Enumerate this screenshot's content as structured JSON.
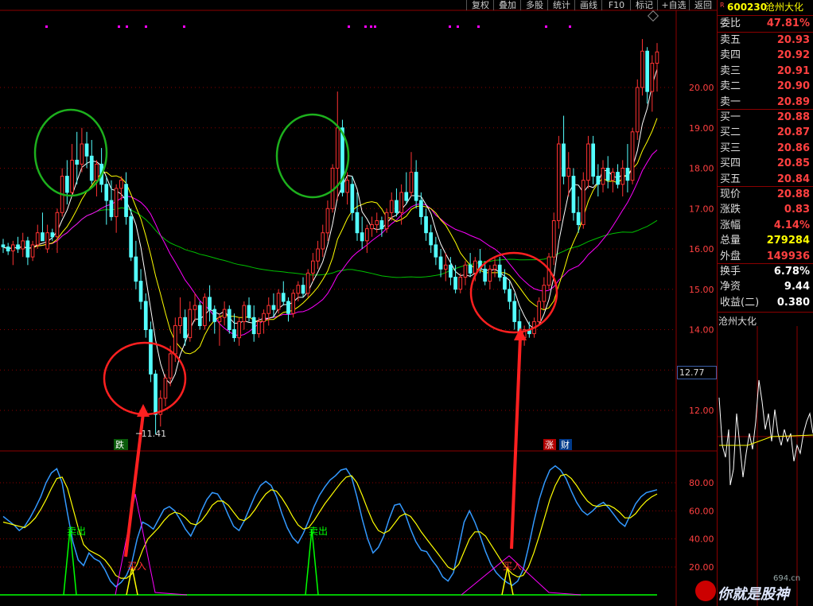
{
  "toolbar": [
    "复权",
    "叠加",
    "多股",
    "统计",
    "画线",
    "F10",
    "标记",
    "+自选",
    "返回"
  ],
  "stock": {
    "code": "600230",
    "name": "沧州大化",
    "marker": "R"
  },
  "quote": {
    "ratio_label": "委比",
    "ratio_value": "47.81%",
    "asks": [
      {
        "label": "卖五",
        "price": "20.93"
      },
      {
        "label": "卖四",
        "price": "20.92"
      },
      {
        "label": "卖三",
        "price": "20.91"
      },
      {
        "label": "卖二",
        "price": "20.90"
      },
      {
        "label": "卖一",
        "price": "20.89"
      }
    ],
    "bids": [
      {
        "label": "买一",
        "price": "20.88"
      },
      {
        "label": "买二",
        "price": "20.87"
      },
      {
        "label": "买三",
        "price": "20.86"
      },
      {
        "label": "买四",
        "price": "20.85"
      },
      {
        "label": "买五",
        "price": "20.84"
      }
    ],
    "stats": [
      {
        "label": "现价",
        "value": "20.88",
        "color": "#ff4040"
      },
      {
        "label": "涨跌",
        "value": "0.83",
        "color": "#ff4040"
      },
      {
        "label": "涨幅",
        "value": "4.14%",
        "color": "#ff4040"
      },
      {
        "label": "总量",
        "value": "279284",
        "color": "#ffff00"
      },
      {
        "label": "外盘",
        "value": "149936",
        "color": "#ff4040"
      }
    ],
    "stats2": [
      {
        "label": "换手",
        "value": "6.78%",
        "color": "#ffffff"
      },
      {
        "label": "净资",
        "value": "9.44",
        "color": "#ffffff"
      },
      {
        "label": "收益(二)",
        "value": "0.380",
        "color": "#ffffff"
      }
    ]
  },
  "mini_chart": {
    "title": "沧州大化"
  },
  "cursor_price": "12.77",
  "low_label": "11.41",
  "tags": {
    "die": "跌",
    "zhang": "涨",
    "cai": "财"
  },
  "signals": {
    "sell": "卖出",
    "buy": "买入"
  },
  "watermark": {
    "text": "你就是股神",
    "site": "694.cn"
  },
  "colors": {
    "up": "#ff3232",
    "down": "#54ffff",
    "ma5": "#ffffff",
    "ma10": "#ffff00",
    "ma20": "#ff00ff",
    "ma60": "#00c000",
    "k_line": "#ffff00",
    "d_line": "#3399ff",
    "circle_green": "#1db01d",
    "circle_red": "#ff2020"
  },
  "chart_data": [
    {
      "type": "candlestick",
      "y_ticks": [
        12.0,
        13.0,
        14.0,
        15.0,
        16.0,
        17.0,
        18.0,
        19.0,
        20.0
      ],
      "ylim": [
        11.0,
        21.0
      ],
      "candles": [
        [
          16.1,
          16.25,
          15.9,
          16.05
        ],
        [
          16.05,
          16.15,
          15.85,
          15.95
        ],
        [
          15.95,
          16.2,
          15.6,
          16.1
        ],
        [
          16.1,
          16.3,
          15.9,
          16.0
        ],
        [
          16.0,
          16.4,
          15.8,
          16.2
        ],
        [
          16.2,
          16.3,
          15.6,
          15.8
        ],
        [
          15.8,
          16.2,
          15.7,
          16.1
        ],
        [
          16.1,
          16.6,
          16.0,
          16.4
        ],
        [
          16.4,
          16.9,
          16.3,
          16.2
        ],
        [
          16.0,
          16.6,
          15.9,
          16.4
        ],
        [
          16.4,
          16.5,
          16.2,
          16.3
        ],
        [
          16.3,
          17.0,
          15.9,
          16.9
        ],
        [
          16.9,
          18.0,
          16.8,
          17.8
        ],
        [
          17.8,
          18.2,
          17.1,
          17.4
        ],
        [
          17.4,
          18.6,
          17.3,
          18.2
        ],
        [
          18.2,
          18.9,
          17.6,
          18.1
        ],
        [
          18.1,
          19.0,
          17.9,
          18.6
        ],
        [
          18.6,
          18.9,
          18.0,
          18.3
        ],
        [
          18.3,
          18.7,
          17.6,
          17.7
        ],
        [
          17.7,
          18.2,
          17.3,
          18.1
        ],
        [
          18.1,
          18.5,
          17.4,
          17.6
        ],
        [
          17.6,
          17.8,
          16.6,
          17.2
        ],
        [
          17.2,
          17.7,
          16.7,
          16.8
        ],
        [
          16.8,
          17.6,
          16.4,
          17.5
        ],
        [
          17.5,
          17.8,
          17.2,
          17.7
        ],
        [
          17.6,
          17.9,
          16.6,
          16.8
        ],
        [
          16.8,
          17.0,
          15.7,
          15.8
        ],
        [
          15.8,
          16.2,
          15.0,
          15.2
        ],
        [
          15.2,
          15.5,
          14.5,
          14.7
        ],
        [
          14.7,
          14.9,
          13.8,
          14.0
        ],
        [
          14.0,
          14.2,
          12.7,
          12.9
        ],
        [
          12.9,
          13.0,
          11.41,
          11.9
        ],
        [
          11.9,
          12.5,
          11.6,
          12.3
        ],
        [
          12.3,
          12.9,
          12.1,
          12.8
        ],
        [
          12.8,
          13.6,
          12.6,
          13.4
        ],
        [
          13.4,
          14.3,
          13.2,
          14.1
        ],
        [
          14.1,
          14.8,
          13.9,
          14.3
        ],
        [
          14.3,
          14.5,
          13.6,
          13.8
        ],
        [
          13.8,
          14.7,
          13.7,
          14.5
        ],
        [
          14.5,
          14.9,
          14.2,
          14.6
        ],
        [
          14.6,
          14.7,
          14.0,
          14.1
        ],
        [
          14.1,
          14.9,
          14.0,
          14.8
        ],
        [
          14.8,
          15.1,
          14.2,
          14.5
        ],
        [
          14.5,
          14.6,
          13.9,
          14.2
        ],
        [
          14.2,
          14.4,
          13.6,
          14.3
        ],
        [
          14.3,
          14.7,
          14.1,
          14.5
        ],
        [
          14.5,
          14.6,
          13.9,
          14.0
        ],
        [
          14.0,
          14.4,
          13.7,
          13.8
        ],
        [
          13.8,
          14.3,
          13.6,
          14.2
        ],
        [
          14.2,
          14.7,
          14.0,
          14.6
        ],
        [
          14.6,
          14.8,
          14.2,
          14.3
        ],
        [
          14.3,
          14.6,
          13.7,
          13.9
        ],
        [
          13.9,
          14.3,
          13.8,
          14.2
        ],
        [
          14.2,
          14.5,
          13.9,
          14.4
        ],
        [
          14.4,
          14.8,
          14.1,
          14.6
        ],
        [
          14.6,
          14.9,
          14.3,
          14.5
        ],
        [
          14.5,
          15.0,
          14.4,
          14.9
        ],
        [
          14.9,
          15.2,
          14.6,
          14.7
        ],
        [
          14.7,
          14.8,
          14.2,
          14.4
        ],
        [
          14.4,
          15.0,
          14.3,
          14.9
        ],
        [
          14.9,
          15.2,
          14.7,
          15.1
        ],
        [
          15.1,
          15.3,
          14.8,
          14.9
        ],
        [
          14.9,
          15.5,
          14.8,
          15.4
        ],
        [
          15.4,
          15.9,
          15.2,
          15.7
        ],
        [
          15.7,
          16.2,
          15.5,
          16.0
        ],
        [
          16.0,
          16.6,
          15.8,
          16.4
        ],
        [
          16.4,
          17.2,
          16.2,
          17.0
        ],
        [
          17.0,
          18.1,
          16.9,
          18.0
        ],
        [
          18.0,
          19.9,
          17.2,
          19.0
        ],
        [
          19.0,
          19.2,
          17.3,
          17.4
        ],
        [
          17.4,
          17.9,
          17.1,
          17.7
        ],
        [
          17.6,
          17.8,
          16.7,
          16.9
        ],
        [
          16.9,
          17.4,
          16.2,
          16.4
        ],
        [
          16.4,
          16.8,
          16.0,
          16.2
        ],
        [
          16.2,
          16.6,
          15.9,
          16.5
        ],
        [
          16.5,
          16.8,
          16.3,
          16.6
        ],
        [
          16.6,
          16.9,
          16.4,
          16.7
        ],
        [
          16.7,
          16.8,
          16.3,
          16.5
        ],
        [
          16.5,
          17.0,
          16.4,
          16.9
        ],
        [
          16.9,
          17.4,
          16.7,
          17.2
        ],
        [
          17.2,
          17.5,
          16.8,
          16.9
        ],
        [
          16.9,
          17.6,
          16.6,
          17.4
        ],
        [
          17.4,
          17.9,
          17.1,
          17.2
        ],
        [
          17.4,
          18.4,
          17.3,
          17.9
        ],
        [
          17.9,
          18.2,
          17.0,
          17.2
        ],
        [
          17.2,
          17.4,
          16.6,
          16.8
        ],
        [
          16.8,
          17.0,
          16.2,
          16.4
        ],
        [
          16.4,
          16.6,
          15.9,
          16.1
        ],
        [
          16.1,
          16.3,
          15.6,
          15.8
        ],
        [
          15.8,
          16.0,
          15.3,
          15.5
        ],
        [
          15.5,
          15.9,
          15.2,
          15.6
        ],
        [
          15.6,
          15.8,
          15.1,
          15.3
        ],
        [
          15.3,
          15.6,
          14.9,
          15.0
        ],
        [
          15.0,
          15.4,
          14.9,
          15.3
        ],
        [
          15.3,
          15.7,
          15.1,
          15.6
        ],
        [
          15.6,
          15.9,
          15.3,
          15.4
        ],
        [
          15.4,
          15.8,
          15.2,
          15.7
        ],
        [
          15.7,
          16.0,
          15.4,
          15.5
        ],
        [
          15.5,
          15.7,
          15.1,
          15.2
        ],
        [
          15.2,
          15.6,
          15.0,
          15.5
        ],
        [
          15.5,
          15.8,
          15.3,
          15.6
        ],
        [
          15.6,
          15.8,
          15.2,
          15.3
        ],
        [
          15.3,
          15.5,
          14.9,
          15.0
        ],
        [
          15.0,
          15.2,
          14.5,
          14.7
        ],
        [
          14.7,
          14.9,
          14.0,
          14.2
        ],
        [
          14.2,
          14.5,
          13.7,
          13.8
        ],
        [
          13.8,
          14.1,
          13.6,
          14.0
        ],
        [
          14.0,
          14.2,
          13.8,
          13.9
        ],
        [
          13.9,
          14.3,
          13.8,
          14.2
        ],
        [
          14.2,
          14.8,
          14.1,
          14.7
        ],
        [
          14.7,
          15.3,
          14.5,
          15.1
        ],
        [
          15.1,
          15.9,
          15.0,
          15.8
        ],
        [
          15.8,
          16.9,
          15.6,
          16.7
        ],
        [
          16.7,
          18.8,
          16.5,
          18.6
        ],
        [
          18.6,
          19.3,
          17.6,
          17.8
        ],
        [
          17.8,
          18.4,
          17.3,
          18.0
        ],
        [
          17.8,
          18.0,
          16.7,
          16.9
        ],
        [
          16.9,
          17.3,
          16.4,
          16.6
        ],
        [
          16.6,
          17.9,
          16.5,
          17.7
        ],
        [
          17.7,
          18.8,
          17.5,
          18.6
        ],
        [
          18.6,
          18.8,
          17.6,
          17.8
        ],
        [
          17.8,
          18.1,
          17.3,
          17.6
        ],
        [
          17.6,
          18.2,
          17.4,
          18.0
        ],
        [
          18.0,
          18.3,
          17.5,
          17.7
        ],
        [
          17.7,
          18.0,
          17.4,
          17.9
        ],
        [
          17.9,
          18.1,
          17.5,
          17.6
        ],
        [
          17.6,
          18.2,
          17.3,
          18.0
        ],
        [
          18.0,
          18.6,
          17.4,
          17.7
        ],
        [
          17.7,
          19.0,
          17.6,
          18.9
        ],
        [
          18.9,
          20.2,
          18.7,
          20.0
        ],
        [
          20.0,
          21.2,
          19.8,
          20.9
        ],
        [
          20.9,
          21.0,
          19.6,
          19.9
        ],
        [
          19.9,
          20.8,
          19.4,
          20.6
        ],
        [
          20.6,
          21.1,
          19.9,
          20.88
        ]
      ],
      "annotations": [
        "跌",
        "11.41",
        "涨",
        "财"
      ]
    },
    {
      "type": "line",
      "y_ticks": [
        20.0,
        40.0,
        60.0,
        80.0
      ],
      "ylim": [
        0,
        100
      ],
      "series": [
        {
          "values": [
            56,
            53,
            50,
            46,
            49,
            55,
            62,
            70,
            80,
            87,
            90,
            80,
            58,
            38,
            25,
            21,
            30,
            26,
            24,
            18,
            10,
            6,
            9,
            14,
            23,
            40,
            52,
            50,
            47,
            54,
            61,
            63,
            60,
            54,
            47,
            42,
            50,
            60,
            68,
            73,
            72,
            66,
            57,
            49,
            46,
            53,
            62,
            71,
            78,
            81,
            78,
            70,
            58,
            48,
            41,
            37,
            44,
            53,
            63,
            71,
            77,
            82,
            85,
            89,
            90,
            84,
            70,
            54,
            40,
            30,
            34,
            42,
            54,
            64,
            65,
            58,
            47,
            38,
            32,
            31,
            25,
            20,
            13,
            10,
            16,
            34,
            52,
            60,
            52,
            42,
            31,
            22,
            16,
            12,
            9,
            7,
            10,
            18,
            34,
            52,
            68,
            80,
            89,
            92,
            89,
            83,
            74,
            66,
            60,
            57,
            60,
            64,
            66,
            62,
            57,
            52,
            49,
            57,
            65,
            70,
            73,
            74,
            75
          ]
        },
        {
          "values": [
            52,
            51,
            50,
            49,
            48,
            51,
            55,
            61,
            68,
            76,
            83,
            84,
            76,
            62,
            48,
            36,
            32,
            30,
            28,
            25,
            20,
            14,
            12,
            12,
            15,
            22,
            32,
            40,
            44,
            48,
            53,
            57,
            59,
            58,
            55,
            51,
            50,
            53,
            58,
            64,
            67,
            67,
            64,
            59,
            54,
            53,
            56,
            61,
            67,
            72,
            75,
            74,
            69,
            63,
            56,
            50,
            47,
            48,
            53,
            59,
            65,
            70,
            75,
            80,
            84,
            85,
            80,
            71,
            61,
            52,
            46,
            44,
            46,
            51,
            56,
            58,
            56,
            51,
            45,
            40,
            35,
            30,
            25,
            20,
            18,
            22,
            31,
            40,
            45,
            45,
            42,
            36,
            30,
            24,
            19,
            15,
            13,
            14,
            20,
            30,
            42,
            55,
            68,
            78,
            85,
            86,
            83,
            78,
            72,
            67,
            64,
            63,
            64,
            64,
            62,
            59,
            55,
            55,
            58,
            63,
            67,
            70,
            72
          ]
        }
      ],
      "signal_labels": [
        "卖出",
        "卖出",
        "买入",
        "买入"
      ]
    }
  ]
}
